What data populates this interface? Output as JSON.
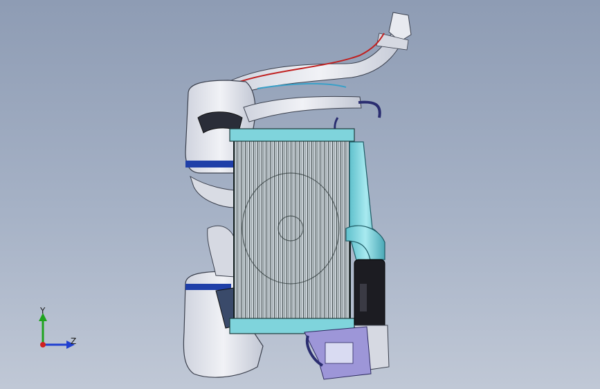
{
  "viewport": {
    "background_top": "#8e9cb4",
    "background_bottom": "#c0c8d6"
  },
  "model": {
    "tank_color": "#e4e6ee",
    "radiator_color": "#1d2a2a",
    "coolant_pipe_color": "#7fd4dc",
    "hose_color": "#4a5a70",
    "wiring_color": "#c02020",
    "stripe_color": "#1f3fa8",
    "fan_shroud_color": "#1c1c22",
    "bracket_color": "#9d96d8"
  },
  "triad": {
    "y_label": "Y",
    "z_label": "Z",
    "y_color": "#1fa31f",
    "z_color": "#1f3fd0",
    "x_color": "#d02020"
  }
}
